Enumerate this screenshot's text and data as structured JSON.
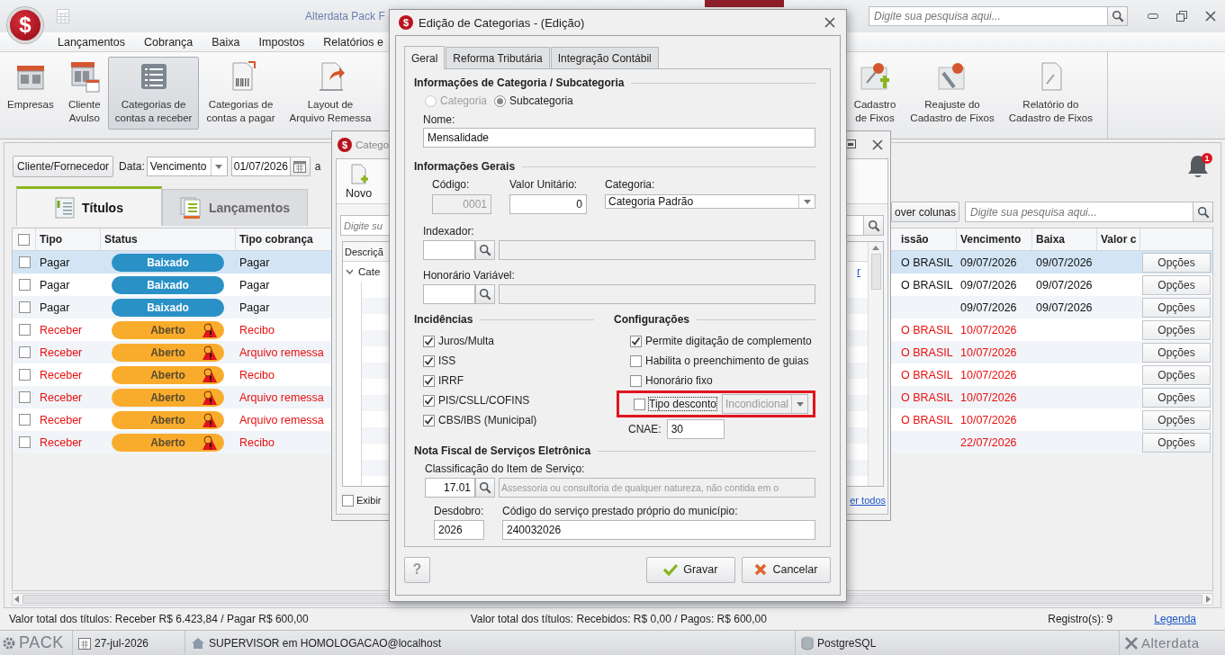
{
  "app": {
    "logo_symbol": "$",
    "title": "Alterdata Pack F",
    "search_placeholder": "Digite sua pesquisa aqui..."
  },
  "menu": [
    "Lançamentos",
    "Cobrança",
    "Baixa",
    "Impostos",
    "Relatórios e"
  ],
  "ribbon_left": [
    {
      "label": "Empresas",
      "kind": "store",
      "selected": false
    },
    {
      "label": "Cliente Avulso",
      "kind": "store-calendar",
      "selected": false
    },
    {
      "label": "Categorias de contas a receber",
      "kind": "list",
      "selected": true
    },
    {
      "label": "Categorias de contas a pagar",
      "kind": "barcode",
      "selected": false
    },
    {
      "label": "Layout de Arquivo Remessa",
      "kind": "export",
      "selected": false
    }
  ],
  "ribbon_right": [
    {
      "label": "Cadastro de Fixos",
      "kind": "pin-plus",
      "selected": false
    },
    {
      "label": "Reajuste do Cadastro de Fixos",
      "kind": "pin-wrench",
      "selected": false
    },
    {
      "label": "Relatório do Cadastro de Fixos",
      "kind": "report",
      "selected": false
    }
  ],
  "filter": {
    "client_button": "Cliente/Fornecedor",
    "date_label": "Data:",
    "date_type": "Vencimento",
    "date_from": "01/07/2026",
    "to_label": "a"
  },
  "notifications": {
    "count": "1"
  },
  "tabs": [
    {
      "label": "Títulos",
      "kind": "titles",
      "selected": true
    },
    {
      "label": "Lançamentos",
      "kind": "entries",
      "selected": false
    }
  ],
  "grid_tools": {
    "columns_button": "over colunas",
    "search_placeholder": "Digite sua pesquisa aqui..."
  },
  "table": {
    "all_checked": false,
    "columns_left": [
      "Tipo",
      "Status",
      "Tipo cobrança"
    ],
    "columns_right": [
      "issão",
      "Vencimento",
      "Baixa",
      "Valor c"
    ],
    "rows": [
      {
        "selected": true,
        "checked": false,
        "kind": "pay",
        "tipo": "Pagar",
        "status": {
          "label": "Baixado",
          "kind": "settled"
        },
        "tipo_cobranca": "Pagar",
        "column_4": "O BRASIL",
        "vencimento": "09/07/2026",
        "baixa": "09/07/2026",
        "options": "Opções"
      },
      {
        "selected": false,
        "checked": false,
        "kind": "pay",
        "tipo": "Pagar",
        "status": {
          "label": "Baixado",
          "kind": "settled"
        },
        "tipo_cobranca": "Pagar",
        "column_4": "O BRASIL",
        "vencimento": "09/07/2026",
        "baixa": "09/07/2026",
        "options": "Opções"
      },
      {
        "selected": false,
        "checked": false,
        "kind": "pay",
        "tipo": "Pagar",
        "status": {
          "label": "Baixado",
          "kind": "settled"
        },
        "tipo_cobranca": "Pagar",
        "vencimento": "09/07/2026",
        "baixa": "09/07/2026",
        "options": "Opções"
      },
      {
        "selected": false,
        "checked": false,
        "kind": "receive",
        "tipo": "Receber",
        "status": {
          "label": "Aberto",
          "kind": "open"
        },
        "tipo_cobranca": "Recibo",
        "column_4": "O BRASIL",
        "vencimento": "10/07/2026",
        "options": "Opções"
      },
      {
        "selected": false,
        "checked": false,
        "kind": "receive",
        "tipo": "Receber",
        "status": {
          "label": "Aberto",
          "kind": "open"
        },
        "tipo_cobranca": "Arquivo remessa",
        "column_4": "O BRASIL",
        "vencimento": "10/07/2026",
        "options": "Opções"
      },
      {
        "selected": false,
        "checked": false,
        "kind": "receive",
        "tipo": "Receber",
        "status": {
          "label": "Aberto",
          "kind": "open"
        },
        "tipo_cobranca": "Recibo",
        "column_4": "O BRASIL",
        "vencimento": "10/07/2026",
        "options": "Opções"
      },
      {
        "selected": false,
        "checked": false,
        "kind": "receive",
        "tipo": "Receber",
        "status": {
          "label": "Aberto",
          "kind": "open"
        },
        "tipo_cobranca": "Arquivo remessa",
        "column_4": "O BRASIL",
        "vencimento": "10/07/2026",
        "options": "Opções"
      },
      {
        "selected": false,
        "checked": false,
        "kind": "receive",
        "tipo": "Receber",
        "status": {
          "label": "Aberto",
          "kind": "open"
        },
        "tipo_cobranca": "Arquivo remessa",
        "column_4": "O BRASIL",
        "vencimento": "10/07/2026",
        "options": "Opções"
      },
      {
        "selected": false,
        "checked": false,
        "kind": "receive",
        "tipo": "Receber",
        "status": {
          "label": "Aberto",
          "kind": "open"
        },
        "tipo_cobranca": "Recibo",
        "vencimento": "22/07/2026",
        "options": "Opções"
      }
    ]
  },
  "footer": {
    "totals_left": "Valor total dos títulos: Receber R$ 6.423,84 / Pagar R$ 600,00",
    "totals_right": "Valor total dos títulos: Recebidos: R$ 0,00 / Pagos: R$ 600,00",
    "records": "Registro(s): 9",
    "legend": "Legenda"
  },
  "taskbar": {
    "logo": "PACK",
    "date": "27-jul-2026",
    "user": "SUPERVISOR em HOMOLOGACAO@localhost",
    "database": "PostgreSQL",
    "brand": "Alterdata"
  },
  "category_window": {
    "icon_symbol": "$",
    "title": "Catego",
    "new_button": "Novo",
    "search_placeholder": "Digite su",
    "tree_header": "Descriçã",
    "tree_item": {
      "label": "Cate",
      "expanded": true
    },
    "row_link": "r",
    "show_checkbox": {
      "label": "Exibir",
      "checked": false
    },
    "bottom_link": "er todos"
  },
  "edit_dialog": {
    "icon_symbol": "$",
    "title": "Edição de Categorias - (Edição)",
    "tabs": [
      {
        "label": "Geral",
        "selected": true
      },
      {
        "label": "Reforma Tributária",
        "selected": false
      },
      {
        "label": "Integração Contábil",
        "selected": false
      }
    ],
    "section_1": "Informações de Categoria / Subcategoria",
    "type_options": [
      {
        "label": "Categoria",
        "selected": false,
        "disabled": true
      },
      {
        "label": "Subcategoria",
        "selected": true,
        "disabled": false
      }
    ],
    "name_label": "Nome:",
    "name_value": "Mensalidade",
    "section_2": "Informações Gerais",
    "code_label": "Código:",
    "code_value": "0001",
    "unit_label": "Valor Unitário:",
    "unit_value": "0",
    "category_label": "Categoria:",
    "category_value": "Categoria Padrão",
    "indexer_label": "Indexador:",
    "fee_label": "Honorário Variável:",
    "incidences": {
      "title": "Incidências",
      "items": [
        {
          "label": "Juros/Multa",
          "checked": true
        },
        {
          "label": "ISS",
          "checked": true
        },
        {
          "label": "IRRF",
          "checked": true
        },
        {
          "label": "PIS/CSLL/COFINS",
          "checked": true
        },
        {
          "label": "CBS/IBS (Municipal)",
          "checked": true
        }
      ]
    },
    "config": {
      "title": "Configurações",
      "items": [
        {
          "label": "Permite digitação de complemento",
          "checked": true
        },
        {
          "label": "Habilita o preenchimento de guias",
          "checked": false
        },
        {
          "label": "Honorário fixo",
          "checked": false
        }
      ],
      "discount": {
        "label": "Tipo desconto",
        "checked": false,
        "value": "Incondicional",
        "highlighted": true
      },
      "cnae_label": "CNAE:",
      "cnae_value": "30"
    },
    "nfse": {
      "title": "Nota Fiscal de Serviços Eletrônica",
      "class_label": "Classificação do Item de Serviço:",
      "class_code": "17.01",
      "class_desc": "Assessoria ou consultoria de qualquer natureza, não contida em o",
      "split_label": "Desdobro:",
      "split_value": "2026",
      "service_label": "Código do serviço prestado próprio do município:",
      "service_value": "240032026"
    },
    "help": "?",
    "save": "Gravar",
    "cancel": "Cancelar"
  }
}
